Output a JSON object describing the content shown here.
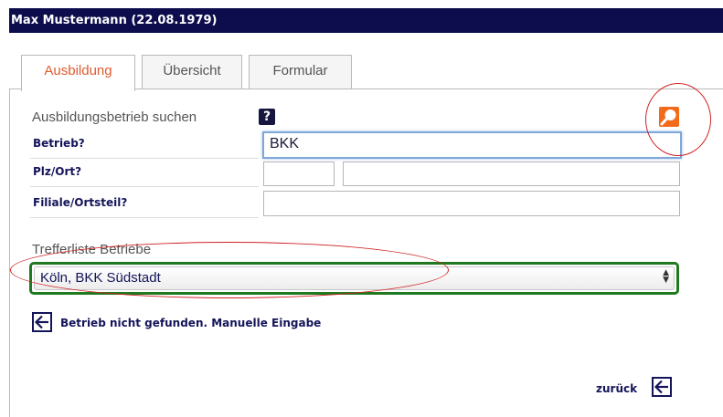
{
  "header": {
    "title": "Max Mustermann (22.08.1979)"
  },
  "tabs": [
    {
      "label": "Ausbildung",
      "active": true
    },
    {
      "label": "Übersicht",
      "active": false
    },
    {
      "label": "Formular",
      "active": false
    }
  ],
  "search": {
    "heading": "Ausbildungsbetrieb suchen",
    "help_label": "?",
    "fields": {
      "betrieb": {
        "label": "Betrieb?",
        "value": "BKK"
      },
      "plz_ort": {
        "label": "Plz/Ort?",
        "plz_value": "",
        "ort_value": ""
      },
      "filiale": {
        "label": "Filiale/Ortsteil?",
        "value": ""
      }
    }
  },
  "results": {
    "heading": "Trefferliste Betriebe",
    "selected": "Köln, BKK Südstadt"
  },
  "actions": {
    "not_found_label": "Betrieb nicht gefunden. Manuelle Eingabe",
    "back_label": "zurück"
  },
  "colors": {
    "header_bg": "#0d0d4d",
    "active_tab_text": "#e05a2e",
    "label_text": "#14145a",
    "select_border": "#1f7a1f",
    "annotation_circle": "#d02020",
    "search_button": "#f26a1b"
  },
  "icons": {
    "help": "question-icon",
    "search": "magnifier-search-icon",
    "back": "arrow-back-icon"
  }
}
